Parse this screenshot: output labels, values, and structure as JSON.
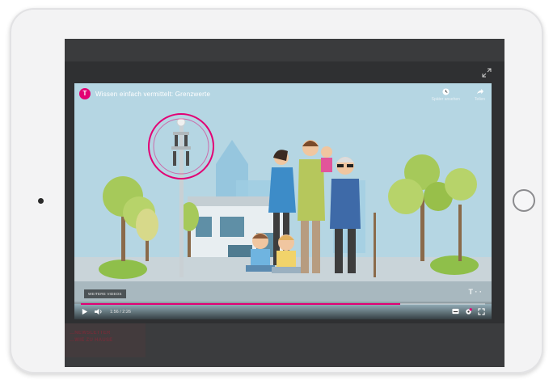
{
  "video": {
    "title": "Wissen einfach vermittelt: Grenzwerte",
    "brand_initial": "T",
    "actions": [
      {
        "label": "Später ansehen",
        "icon": "clock-icon"
      },
      {
        "label": "Teilen",
        "icon": "share-icon"
      }
    ],
    "more_videos_label": "WEITERE VIDEOS",
    "watermark": "T · ·",
    "time": "1:56 / 2:26",
    "progress": 0.79,
    "accent_color": "#e20074"
  },
  "page": {
    "blurred_lines": [
      "…NEWSLETTER",
      "…WIE ZU HAUSE"
    ]
  }
}
